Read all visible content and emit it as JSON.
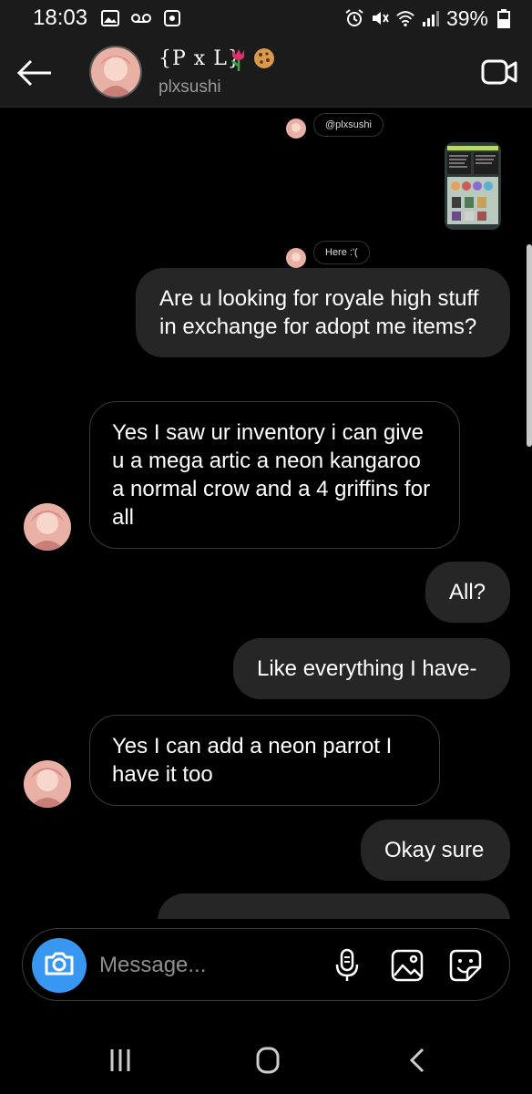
{
  "status_bar": {
    "time": "18:03",
    "battery": "39%"
  },
  "header": {
    "title": "{P x L}",
    "username": "plxsushi",
    "emojis": [
      "tulip",
      "cookie"
    ]
  },
  "shared": {
    "mention": "@plxsushi",
    "caption": "Here :'("
  },
  "messages": [
    {
      "side": "out",
      "text": "Are u looking for royale high stuff in exchange for adopt me items?"
    },
    {
      "side": "in",
      "text": "Yes I saw ur inventory i can give u a mega artic a neon kangaroo a normal crow and a 4 griffins for all"
    },
    {
      "side": "out",
      "text": "All?"
    },
    {
      "side": "out",
      "text": "Like everything I have-"
    },
    {
      "side": "in",
      "text": "Yes I can add a neon parrot I have it too"
    },
    {
      "side": "out",
      "text": "Okay sure"
    }
  ],
  "composer": {
    "placeholder": "Message..."
  },
  "colors": {
    "background": "#000000",
    "outgoing_bubble": "#262626",
    "incoming_border": "#3a3a3a",
    "camera_button": "#3897f0",
    "bars": "#1b1b1b"
  }
}
